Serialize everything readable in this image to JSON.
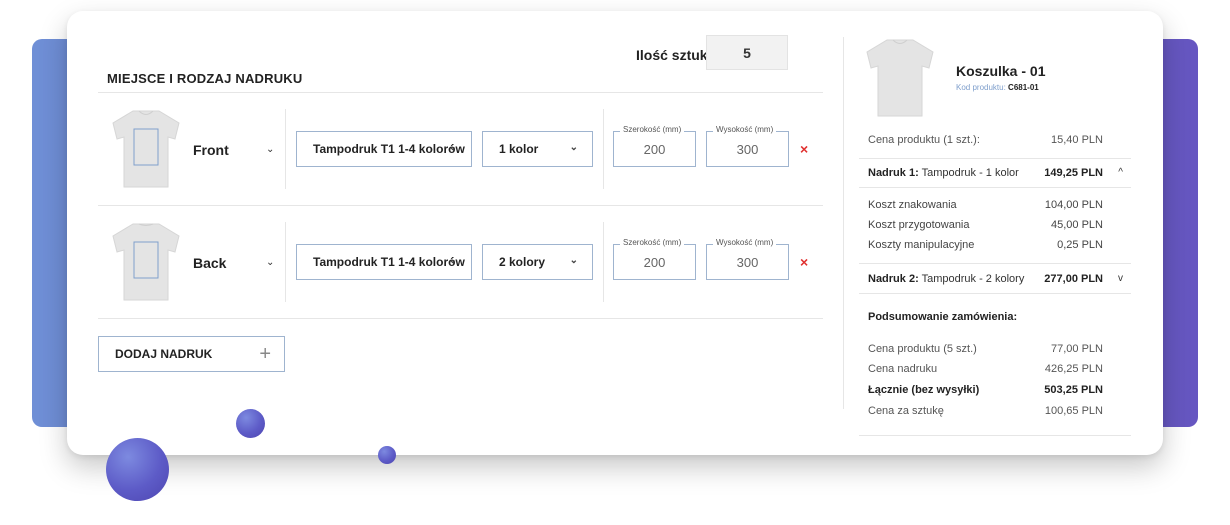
{
  "header": {
    "section_title": "MIEJSCE I RODZAJ NADRUKU",
    "quantity_label": "Ilość sztuk:",
    "quantity_value": "5"
  },
  "prints": [
    {
      "place": "Front",
      "method": "Tampodruk T1 1-4 kolorów",
      "colors": "1 kolor",
      "width_label": "Szerokość (mm)",
      "width_value": "200",
      "height_label": "Wysokość (mm)",
      "height_value": "300",
      "remove_icon": "×"
    },
    {
      "place": "Back",
      "method": "Tampodruk T1 1-4 kolorów",
      "colors": "2 kolory",
      "width_label": "Szerokość (mm)",
      "width_value": "200",
      "height_label": "Wysokość (mm)",
      "height_value": "300",
      "remove_icon": "×"
    }
  ],
  "add_print": {
    "label": "DODAJ NADRUK",
    "icon": "+"
  },
  "product": {
    "name": "Koszulka - 01",
    "code_label": "Kod produktu:",
    "code_value": "C681-01"
  },
  "summary": {
    "unit_price_label": "Cena produktu (1 szt.):",
    "unit_price_value": "15,40 PLN",
    "print1": {
      "key": "Nadruk 1:",
      "desc": "Tampodruk - 1 kolor",
      "value": "149,25 PLN",
      "chevron": "^"
    },
    "costs": [
      {
        "label": "Koszt znakowania",
        "value": "104,00 PLN"
      },
      {
        "label": "Koszt przygotowania",
        "value": "45,00 PLN"
      },
      {
        "label": "Koszty manipulacyjne",
        "value": "0,25 PLN"
      }
    ],
    "print2": {
      "key": "Nadruk 2:",
      "desc": "Tampodruk - 2 kolory",
      "value": "277,00 PLN",
      "chevron": "v"
    },
    "order_title": "Podsumowanie zamówienia:",
    "order_rows": [
      {
        "label": "Cena produktu (5 szt.)",
        "value": "77,00 PLN",
        "bold": false
      },
      {
        "label": "Cena nadruku",
        "value": "426,25 PLN",
        "bold": false
      },
      {
        "label": "Łącznie (bez wysyłki)",
        "value": "503,25 PLN",
        "bold": true
      },
      {
        "label": "Cena za sztukę",
        "value": "100,65 PLN",
        "bold": false
      }
    ]
  },
  "colors": {
    "accent_gradient_start": "#6f8fd6",
    "accent_gradient_end": "#6656c1",
    "input_border": "#9fb4cf",
    "remove_red": "#e0302f",
    "code_label_blue": "#7f9fcc"
  }
}
